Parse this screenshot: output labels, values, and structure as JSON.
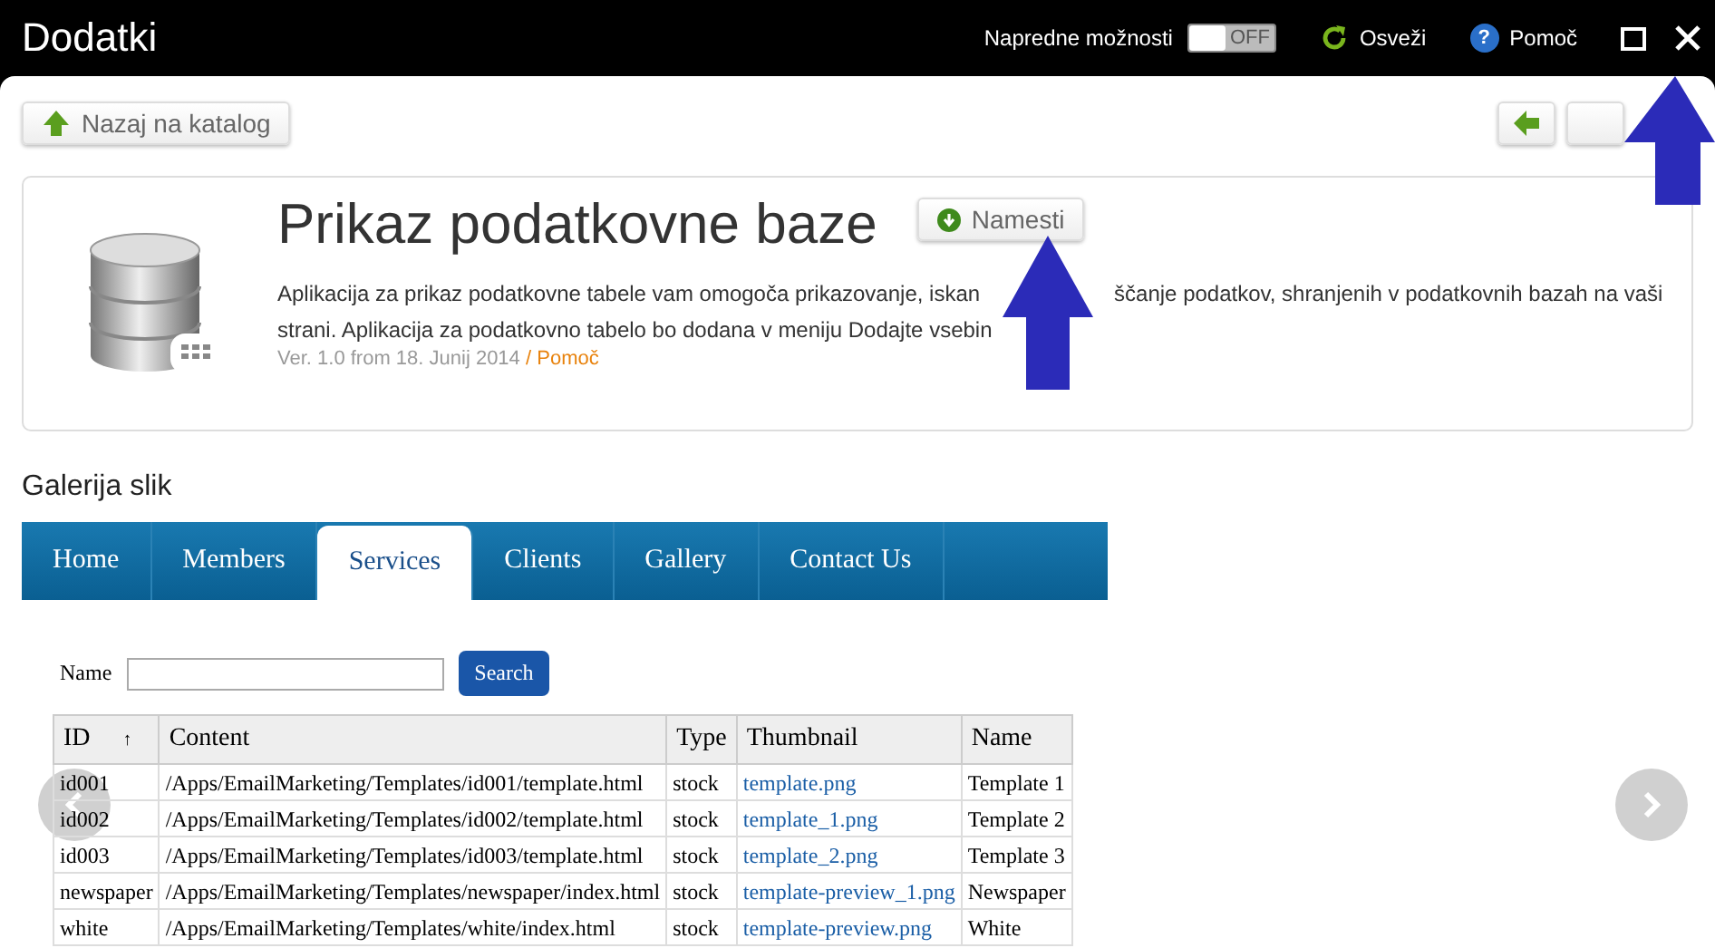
{
  "window": {
    "title": "Dodatki"
  },
  "toolbar": {
    "advanced_label": "Napredne možnosti",
    "advanced_on": false,
    "advanced_state": "OFF",
    "refresh": "Osveži",
    "help_icon": "?",
    "help": "Pomoč"
  },
  "back_button": "Nazaj na katalog",
  "app": {
    "title": "Prikaz podatkovne baze",
    "install_button": "Namesti",
    "description_parts": [
      "Aplikacija za prikaz podatkovne tabele vam omogoča prikazovanje, iskan",
      "ščanje podatkov, shranjenih v podatkovnih bazah na vaši",
      "strani. Aplikacija za podatkovno tabelo bo dodana v meniju Dodajte vsebin"
    ],
    "version": "Ver. 1.0 from 18. Junij 2014",
    "separator": "/",
    "help_link": "Pomoč"
  },
  "gallery": {
    "title": "Galerija slik",
    "tabs": [
      {
        "label": "Home",
        "selected": false
      },
      {
        "label": "Members",
        "selected": false
      },
      {
        "label": "Services",
        "selected": true
      },
      {
        "label": "Clients",
        "selected": false
      },
      {
        "label": "Gallery",
        "selected": false
      },
      {
        "label": "Contact Us",
        "selected": false
      }
    ],
    "search_label": "Name",
    "search_button": "Search",
    "table": {
      "columns": [
        "ID",
        "Content",
        "Type",
        "Thumbnail",
        "Name"
      ],
      "sort_icon": "↑",
      "rows": [
        [
          "id001",
          "/Apps/EmailMarketing/Templates/id001/template.html",
          "stock",
          "template.png",
          "Template 1"
        ],
        [
          "id002",
          "/Apps/EmailMarketing/Templates/id002/template.html",
          "stock",
          "template_1.png",
          "Template 2"
        ],
        [
          "id003",
          "/Apps/EmailMarketing/Templates/id003/template.html",
          "stock",
          "template_2.png",
          "Template 3"
        ],
        [
          "newspaper",
          "/Apps/EmailMarketing/Templates/newspaper/index.html",
          "stock",
          "template-preview_1.png",
          "Newspaper"
        ],
        [
          "white",
          "/Apps/EmailMarketing/Templates/white/index.html",
          "stock",
          "template-preview.png",
          "White"
        ]
      ]
    }
  }
}
